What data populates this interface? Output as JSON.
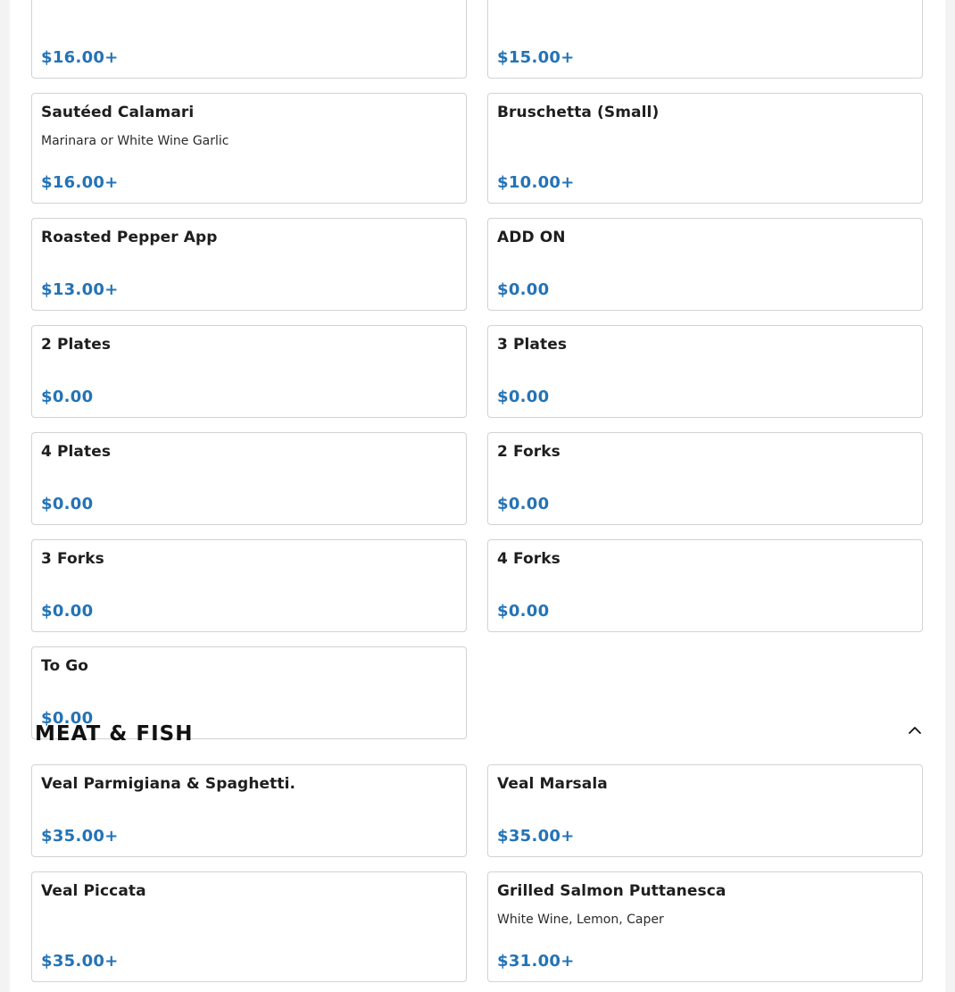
{
  "top_items": [
    {
      "name": "",
      "description": "",
      "price": "$16.00+"
    },
    {
      "name": "",
      "description": "",
      "price": "$15.00+"
    },
    {
      "name": "Sautéed Calamari",
      "description": "Marinara or White Wine Garlic",
      "price": "$16.00+"
    },
    {
      "name": "Bruschetta (Small)",
      "description": "",
      "price": "$10.00+"
    },
    {
      "name": "Roasted Pepper App",
      "description": "",
      "price": "$13.00+"
    },
    {
      "name": "ADD ON",
      "description": "",
      "price": "$0.00"
    },
    {
      "name": "2 Plates",
      "description": "",
      "price": "$0.00"
    },
    {
      "name": "3 Plates",
      "description": "",
      "price": "$0.00"
    },
    {
      "name": "4 Plates",
      "description": "",
      "price": "$0.00"
    },
    {
      "name": "2 Forks",
      "description": "",
      "price": "$0.00"
    },
    {
      "name": "3 Forks",
      "description": "",
      "price": "$0.00"
    },
    {
      "name": "4 Forks",
      "description": "",
      "price": "$0.00"
    },
    {
      "name": "To Go",
      "description": "",
      "price": "$0.00"
    }
  ],
  "meat_section": {
    "title": "MEAT & FISH",
    "collapse_icon": "chevron-up-icon",
    "items": [
      {
        "name": "Veal Parmigiana & Spaghetti.",
        "description": "",
        "price": "$35.00+"
      },
      {
        "name": "Veal Marsala",
        "description": "",
        "price": "$35.00+"
      },
      {
        "name": "Veal Piccata",
        "description": "",
        "price": "$35.00+"
      },
      {
        "name": "Grilled Salmon Puttanesca",
        "description": "White Wine, Lemon, Caper",
        "price": "$31.00+"
      }
    ]
  },
  "colors": {
    "price": "#2473b6",
    "card_border": "#d2d2d2",
    "page_background": "#f3f3f3"
  }
}
